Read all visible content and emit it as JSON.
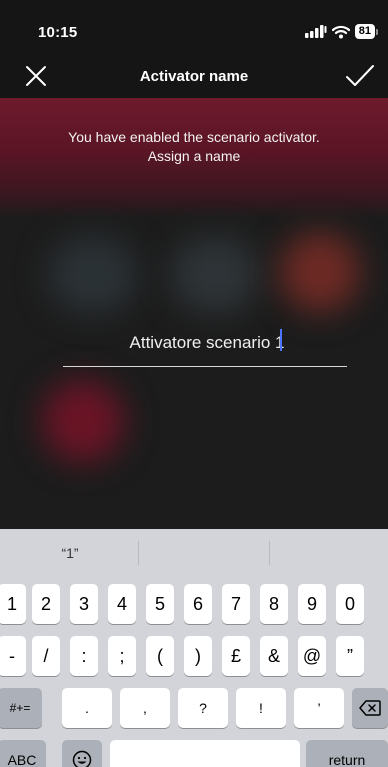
{
  "status_bar": {
    "time": "10:15",
    "battery": "81"
  },
  "nav": {
    "title": "Activator name",
    "close_icon": "close-icon",
    "confirm_icon": "checkmark-icon"
  },
  "message": {
    "line1": "You have enabled the scenario activator.",
    "line2": "Assign a name"
  },
  "name_input": {
    "value": "Attivatore scenario 1"
  },
  "keyboard": {
    "suggestions": [
      "“1”",
      "",
      ""
    ],
    "row1": [
      "1",
      "2",
      "3",
      "4",
      "5",
      "6",
      "7",
      "8",
      "9",
      "0"
    ],
    "row2": [
      "-",
      "/",
      ":",
      ";",
      "(",
      ")",
      "£",
      "&",
      "@",
      "”"
    ],
    "row3": {
      "toggle": "#+=",
      "keys": [
        ".",
        ",",
        "?",
        "!",
        "’"
      ],
      "delete_icon": "backspace-icon"
    },
    "row4": {
      "abc": "ABC",
      "emoji_icon": "emoji-icon",
      "space": "",
      "return": "return"
    }
  },
  "colors": {
    "accent_cursor": "#4a74ff",
    "hero_red": "#6d1a2c",
    "keyboard_bg": "#d2d4d9"
  }
}
